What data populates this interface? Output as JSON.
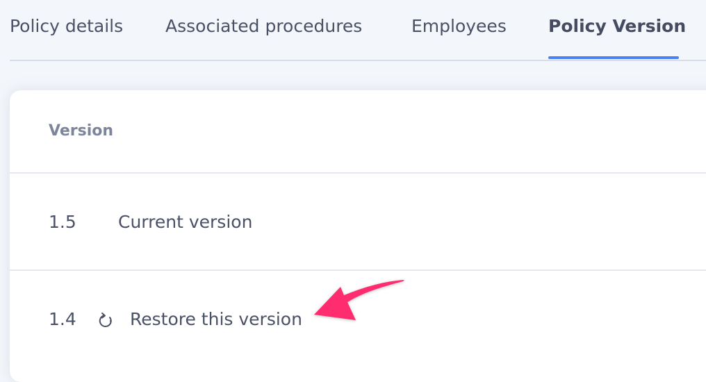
{
  "tabs": [
    {
      "label": "Policy details",
      "active": false
    },
    {
      "label": "Associated procedures",
      "active": false
    },
    {
      "label": "Employees",
      "active": false
    },
    {
      "label": "Policy Version",
      "active": true
    }
  ],
  "colors": {
    "accent": "#4a80f0",
    "annotation_arrow": "#ff2d6f"
  },
  "table": {
    "header": "Version",
    "rows": [
      {
        "version": "1.5",
        "label": "Current version",
        "icon": null
      },
      {
        "version": "1.4",
        "label": "Restore this version",
        "icon": "restore-icon"
      }
    ]
  }
}
